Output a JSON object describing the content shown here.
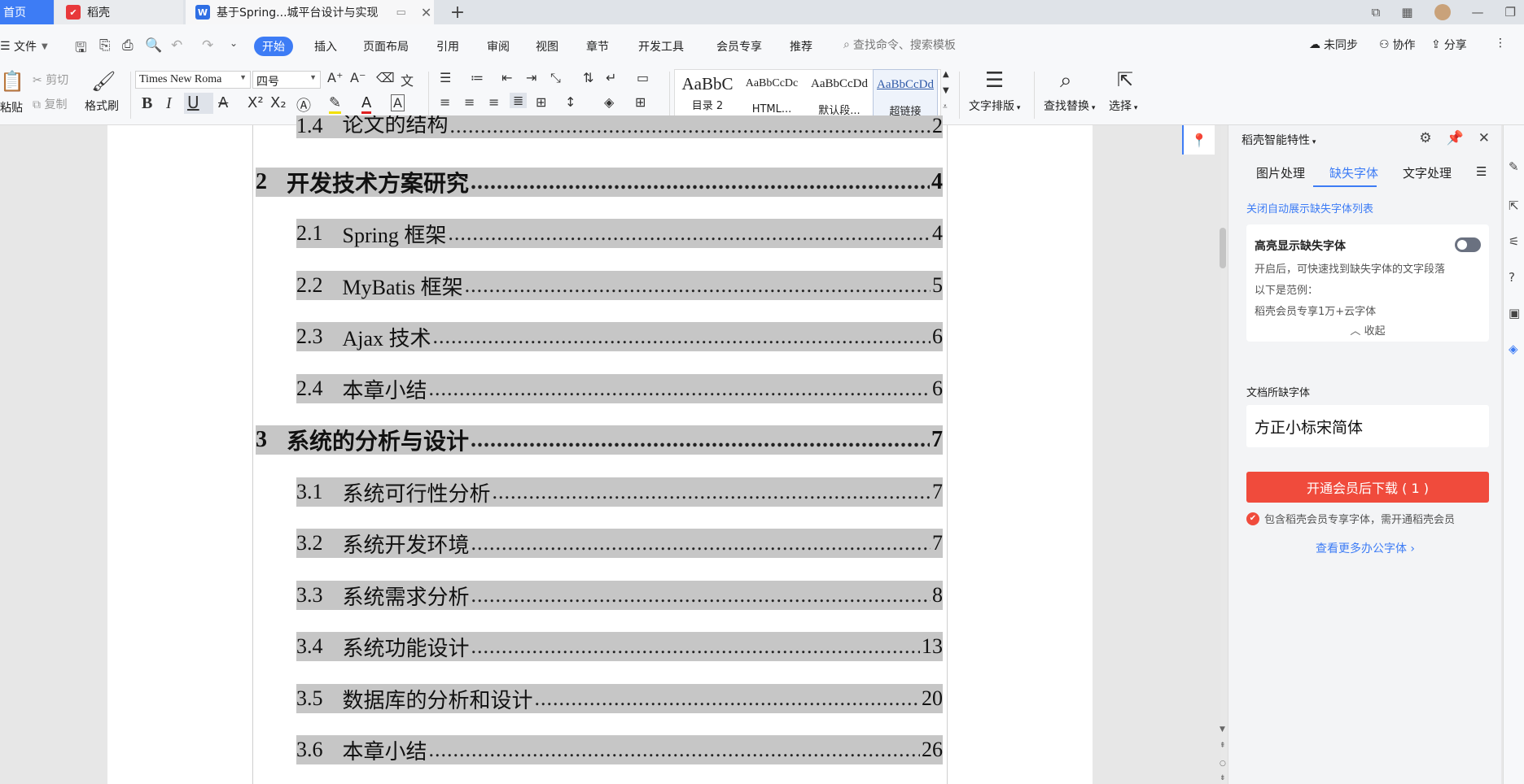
{
  "tabs": {
    "home": "首页",
    "daoke": "稻壳",
    "doc": "基于Spring...城平台设计与实现"
  },
  "menu": {
    "file": "文件",
    "start": "开始",
    "insert": "插入",
    "layout": "页面布局",
    "reference": "引用",
    "review": "审阅",
    "view": "视图",
    "chapter": "章节",
    "devtools": "开发工具",
    "member": "会员专享",
    "recommend": "推荐",
    "search_placeholder": "查找命令、搜索模板",
    "unsync": "未同步",
    "collab": "协作",
    "share": "分享"
  },
  "ribbon": {
    "cut": "剪切",
    "copy": "复制",
    "paste": "粘贴",
    "format_painter": "格式刷",
    "font_name": "Times New Roma",
    "font_size": "四号",
    "styles": [
      {
        "preview": "AaBbC",
        "label": "目录 2"
      },
      {
        "preview": "AaBbCcDc",
        "label": "HTML..."
      },
      {
        "preview": "AaBbCcDd",
        "label": "默认段..."
      },
      {
        "preview": "AaBbCcDd",
        "label": "超链接"
      }
    ],
    "text_layout": "文字排版",
    "find_replace": "查找替换",
    "select": "选择"
  },
  "toc": [
    {
      "num": "1.4",
      "title": "论文的结构",
      "page": "2",
      "level": 2
    },
    {
      "num": "2",
      "title": "开发技术方案研究",
      "page": "4",
      "level": 1
    },
    {
      "num": "2.1",
      "title": "Spring 框架",
      "page": "4",
      "level": 2
    },
    {
      "num": "2.2",
      "title": "MyBatis 框架",
      "page": "5",
      "level": 2
    },
    {
      "num": "2.3",
      "title": "Ajax 技术",
      "page": "6",
      "level": 2
    },
    {
      "num": "2.4",
      "title": "本章小结",
      "page": "6",
      "level": 2
    },
    {
      "num": "3",
      "title": "系统的分析与设计",
      "page": "7",
      "level": 1
    },
    {
      "num": "3.1",
      "title": "系统可行性分析",
      "page": "7",
      "level": 2
    },
    {
      "num": "3.2",
      "title": "系统开发环境",
      "page": "7",
      "level": 2
    },
    {
      "num": "3.3",
      "title": "系统需求分析",
      "page": "8",
      "level": 2
    },
    {
      "num": "3.4",
      "title": "系统功能设计",
      "page": "13",
      "level": 2
    },
    {
      "num": "3.5",
      "title": "数据库的分析和设计",
      "page": "20",
      "level": 2
    },
    {
      "num": "3.6",
      "title": "本章小结",
      "page": "26",
      "level": 2
    }
  ],
  "panel": {
    "header": "稻壳智能特性",
    "tabs": [
      "图片处理",
      "缺失字体",
      "文字处理"
    ],
    "close_auto": "关闭自动展示缺失字体列表",
    "highlight_title": "高亮显示缺失字体",
    "highlight_desc": "开启后，可快速找到缺失字体的文字段落",
    "example_label": "以下是范例：",
    "example_text": "稻壳会员专享1万+云字体",
    "collapse": "收起",
    "missing_label": "文档所缺字体",
    "missing_font": "方正小标宋简体",
    "download_btn": "开通会员后下载 ( 1 )",
    "note": "包含稻壳会员专享字体，需开通稻壳会员",
    "more": "查看更多办公字体"
  },
  "colors": {
    "accent": "#3d7cf5",
    "download": "#f04b3c",
    "highlight": "#c6c6c6"
  }
}
